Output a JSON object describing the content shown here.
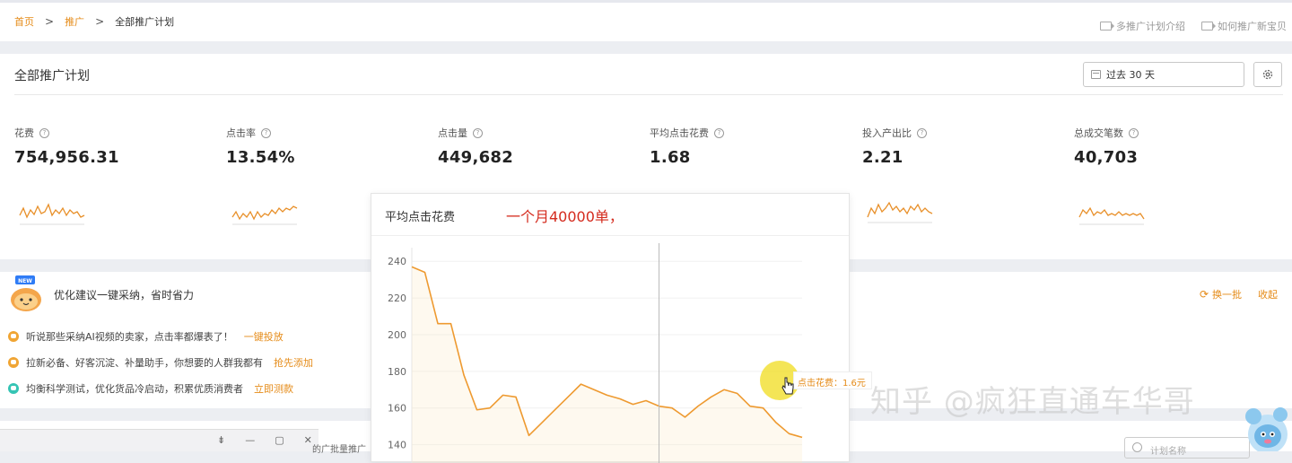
{
  "breadcrumb": {
    "home": "首页",
    "promote": "推广",
    "current": "全部推广计划"
  },
  "top_links": [
    "多推广计划介绍",
    "如何推广新宝贝"
  ],
  "panel": {
    "title": "全部推广计划",
    "date_range": "过去 30 天"
  },
  "metrics": [
    {
      "label": "花费",
      "value": "754,956.31",
      "icon": "question-icon"
    },
    {
      "label": "点击率",
      "value": "13.54%",
      "icon": "question-icon"
    },
    {
      "label": "点击量",
      "value": "449,682",
      "icon": "question-icon"
    },
    {
      "label": "平均点击花费",
      "value": "1.68",
      "icon": "question-icon"
    },
    {
      "label": "投入产出比",
      "value": "2.21",
      "icon": "question-icon"
    },
    {
      "label": "总成交笔数",
      "value": "40,703",
      "icon": "question-icon"
    }
  ],
  "optimize": {
    "title": "优化建议一键采纳，省时省力",
    "badge": "NEW",
    "refresh_label": "换一批",
    "collapse_label": "收起",
    "tips": [
      {
        "text": "听说那些采纳AI视频的卖家，点击率都爆表了！",
        "link": "一键投放",
        "color": "#f0a534"
      },
      {
        "text": "拉新必备、好客沉淀、补量助手，你想要的人群我都有",
        "link": "抢先添加",
        "color": "#f0a534"
      },
      {
        "text": "均衡科学测试，优化货品冷启动，积累优质消费者",
        "link": "立即测款",
        "color": "#35c4b4"
      }
    ]
  },
  "popup": {
    "title": "平均点击花费",
    "annotation": "一个月40000单，",
    "tooltip": "点击花费：1.6元"
  },
  "watermark": "知乎 @疯狂直通车华哥",
  "window_buttons": [
    "⇟",
    "—",
    "▢",
    "✕"
  ],
  "bottom_text": "的广批量推广",
  "search_placeholder": "计划名称",
  "colors": {
    "accent": "#e58b18",
    "line": "#ee9a30",
    "annotation": "#d42b1e"
  },
  "chart_data": {
    "type": "area",
    "title": "平均点击花费",
    "yticks": [
      140,
      160,
      180,
      200,
      220,
      240
    ],
    "ylim": [
      130,
      245
    ],
    "x": [
      0,
      1,
      2,
      3,
      4,
      5,
      6,
      7,
      8,
      9,
      10,
      11,
      12,
      13,
      14,
      15,
      16,
      17,
      18,
      19,
      20,
      21,
      22,
      23,
      24,
      25,
      26,
      27,
      28,
      29,
      30
    ],
    "series": [
      {
        "values": [
          237,
          234,
          206,
          206,
          178,
          159,
          160,
          167,
          166,
          145,
          152,
          159,
          166,
          173,
          170,
          167,
          165,
          162,
          164,
          161,
          160,
          155,
          161,
          166,
          170,
          168,
          161,
          160,
          152,
          146,
          144
        ]
      }
    ],
    "crosshair_x": 19
  }
}
